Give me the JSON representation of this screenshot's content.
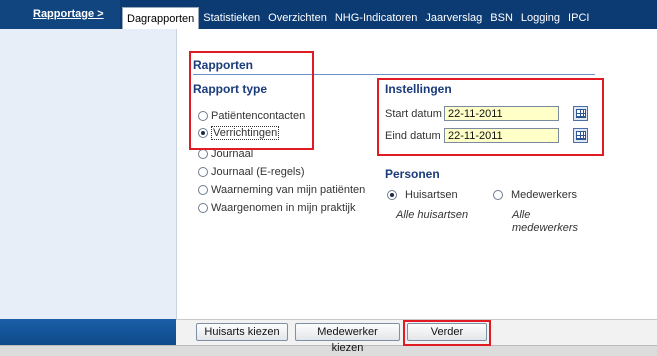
{
  "nav": {
    "breadcrumb": "Rapportage >",
    "tabs": [
      {
        "label": "Dagrapporten",
        "active": true
      },
      {
        "label": "Statistieken",
        "active": false
      },
      {
        "label": "Overzichten",
        "active": false
      },
      {
        "label": "NHG-Indicatoren",
        "active": false
      },
      {
        "label": "Jaarverslag",
        "active": false
      },
      {
        "label": "BSN",
        "active": false
      },
      {
        "label": "Logging",
        "active": false
      },
      {
        "label": "IPCI",
        "active": false
      }
    ]
  },
  "rapporten": {
    "title": "Rapporten",
    "type_title": "Rapport type",
    "types": [
      {
        "label": "Patiëntencontacten",
        "selected": false
      },
      {
        "label": "Verrichtingen",
        "selected": true
      },
      {
        "label": "Journaal",
        "selected": false
      },
      {
        "label": "Journaal (E-regels)",
        "selected": false
      },
      {
        "label": "Waarneming van mijn patiënten",
        "selected": false
      },
      {
        "label": "Waargenomen in mijn praktijk",
        "selected": false
      }
    ]
  },
  "instellingen": {
    "title": "Instellingen",
    "start_label": "Start datum",
    "start_value": "22-11-2011",
    "eind_label": "Eind datum",
    "eind_value": "22-11-2011"
  },
  "personen": {
    "title": "Personen",
    "options": [
      {
        "label": "Huisartsen",
        "selected": true,
        "subtext": "Alle huisartsen"
      },
      {
        "label": "Medewerkers",
        "selected": false,
        "subtext": "Alle medewerkers"
      }
    ]
  },
  "buttons": {
    "huisarts": "Huisarts kiezen",
    "medewerker": "Medewerker kiezen",
    "verder": "Verder"
  },
  "colors": {
    "nav_bg": "#0c3a73",
    "section_title": "#1a3b7a",
    "input_bg": "#ffffc8",
    "highlight": "#e01b24"
  }
}
